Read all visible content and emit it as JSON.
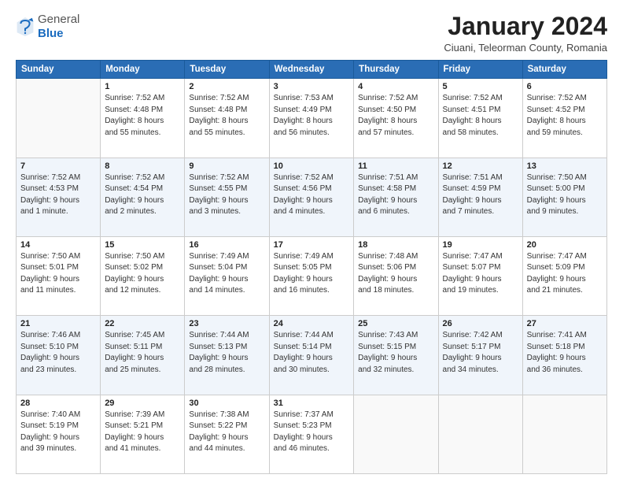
{
  "header": {
    "logo_general": "General",
    "logo_blue": "Blue",
    "month_title": "January 2024",
    "subtitle": "Ciuani, Teleorman County, Romania"
  },
  "weekdays": [
    "Sunday",
    "Monday",
    "Tuesday",
    "Wednesday",
    "Thursday",
    "Friday",
    "Saturday"
  ],
  "weeks": [
    [
      {
        "day": "",
        "info": ""
      },
      {
        "day": "1",
        "info": "Sunrise: 7:52 AM\nSunset: 4:48 PM\nDaylight: 8 hours\nand 55 minutes."
      },
      {
        "day": "2",
        "info": "Sunrise: 7:52 AM\nSunset: 4:48 PM\nDaylight: 8 hours\nand 55 minutes."
      },
      {
        "day": "3",
        "info": "Sunrise: 7:53 AM\nSunset: 4:49 PM\nDaylight: 8 hours\nand 56 minutes."
      },
      {
        "day": "4",
        "info": "Sunrise: 7:52 AM\nSunset: 4:50 PM\nDaylight: 8 hours\nand 57 minutes."
      },
      {
        "day": "5",
        "info": "Sunrise: 7:52 AM\nSunset: 4:51 PM\nDaylight: 8 hours\nand 58 minutes."
      },
      {
        "day": "6",
        "info": "Sunrise: 7:52 AM\nSunset: 4:52 PM\nDaylight: 8 hours\nand 59 minutes."
      }
    ],
    [
      {
        "day": "7",
        "info": "Sunrise: 7:52 AM\nSunset: 4:53 PM\nDaylight: 9 hours\nand 1 minute."
      },
      {
        "day": "8",
        "info": "Sunrise: 7:52 AM\nSunset: 4:54 PM\nDaylight: 9 hours\nand 2 minutes."
      },
      {
        "day": "9",
        "info": "Sunrise: 7:52 AM\nSunset: 4:55 PM\nDaylight: 9 hours\nand 3 minutes."
      },
      {
        "day": "10",
        "info": "Sunrise: 7:52 AM\nSunset: 4:56 PM\nDaylight: 9 hours\nand 4 minutes."
      },
      {
        "day": "11",
        "info": "Sunrise: 7:51 AM\nSunset: 4:58 PM\nDaylight: 9 hours\nand 6 minutes."
      },
      {
        "day": "12",
        "info": "Sunrise: 7:51 AM\nSunset: 4:59 PM\nDaylight: 9 hours\nand 7 minutes."
      },
      {
        "day": "13",
        "info": "Sunrise: 7:50 AM\nSunset: 5:00 PM\nDaylight: 9 hours\nand 9 minutes."
      }
    ],
    [
      {
        "day": "14",
        "info": "Sunrise: 7:50 AM\nSunset: 5:01 PM\nDaylight: 9 hours\nand 11 minutes."
      },
      {
        "day": "15",
        "info": "Sunrise: 7:50 AM\nSunset: 5:02 PM\nDaylight: 9 hours\nand 12 minutes."
      },
      {
        "day": "16",
        "info": "Sunrise: 7:49 AM\nSunset: 5:04 PM\nDaylight: 9 hours\nand 14 minutes."
      },
      {
        "day": "17",
        "info": "Sunrise: 7:49 AM\nSunset: 5:05 PM\nDaylight: 9 hours\nand 16 minutes."
      },
      {
        "day": "18",
        "info": "Sunrise: 7:48 AM\nSunset: 5:06 PM\nDaylight: 9 hours\nand 18 minutes."
      },
      {
        "day": "19",
        "info": "Sunrise: 7:47 AM\nSunset: 5:07 PM\nDaylight: 9 hours\nand 19 minutes."
      },
      {
        "day": "20",
        "info": "Sunrise: 7:47 AM\nSunset: 5:09 PM\nDaylight: 9 hours\nand 21 minutes."
      }
    ],
    [
      {
        "day": "21",
        "info": "Sunrise: 7:46 AM\nSunset: 5:10 PM\nDaylight: 9 hours\nand 23 minutes."
      },
      {
        "day": "22",
        "info": "Sunrise: 7:45 AM\nSunset: 5:11 PM\nDaylight: 9 hours\nand 25 minutes."
      },
      {
        "day": "23",
        "info": "Sunrise: 7:44 AM\nSunset: 5:13 PM\nDaylight: 9 hours\nand 28 minutes."
      },
      {
        "day": "24",
        "info": "Sunrise: 7:44 AM\nSunset: 5:14 PM\nDaylight: 9 hours\nand 30 minutes."
      },
      {
        "day": "25",
        "info": "Sunrise: 7:43 AM\nSunset: 5:15 PM\nDaylight: 9 hours\nand 32 minutes."
      },
      {
        "day": "26",
        "info": "Sunrise: 7:42 AM\nSunset: 5:17 PM\nDaylight: 9 hours\nand 34 minutes."
      },
      {
        "day": "27",
        "info": "Sunrise: 7:41 AM\nSunset: 5:18 PM\nDaylight: 9 hours\nand 36 minutes."
      }
    ],
    [
      {
        "day": "28",
        "info": "Sunrise: 7:40 AM\nSunset: 5:19 PM\nDaylight: 9 hours\nand 39 minutes."
      },
      {
        "day": "29",
        "info": "Sunrise: 7:39 AM\nSunset: 5:21 PM\nDaylight: 9 hours\nand 41 minutes."
      },
      {
        "day": "30",
        "info": "Sunrise: 7:38 AM\nSunset: 5:22 PM\nDaylight: 9 hours\nand 44 minutes."
      },
      {
        "day": "31",
        "info": "Sunrise: 7:37 AM\nSunset: 5:23 PM\nDaylight: 9 hours\nand 46 minutes."
      },
      {
        "day": "",
        "info": ""
      },
      {
        "day": "",
        "info": ""
      },
      {
        "day": "",
        "info": ""
      }
    ]
  ]
}
